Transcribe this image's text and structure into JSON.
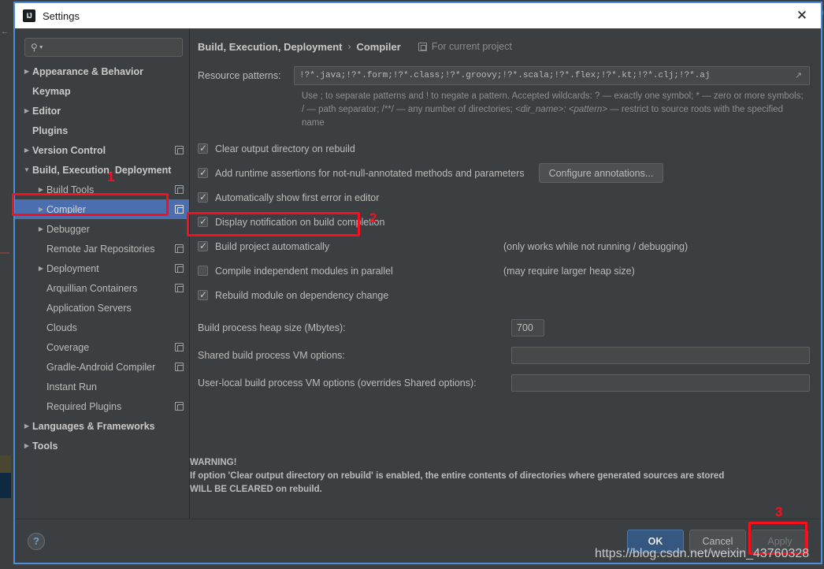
{
  "window": {
    "title": "Settings",
    "app_icon": "intellij-idea-icon",
    "close_label": "✕"
  },
  "sidebar": {
    "search": {
      "placeholder": "",
      "value": "",
      "icon": "search-icon"
    },
    "items": [
      {
        "label": "Appearance & Behavior",
        "indent": 0,
        "bold": true,
        "twisty": "▶",
        "selected": false,
        "project_icon": false
      },
      {
        "label": "Keymap",
        "indent": 0,
        "bold": true,
        "twisty": "",
        "selected": false,
        "project_icon": false
      },
      {
        "label": "Editor",
        "indent": 0,
        "bold": true,
        "twisty": "▶",
        "selected": false,
        "project_icon": false
      },
      {
        "label": "Plugins",
        "indent": 0,
        "bold": true,
        "twisty": "",
        "selected": false,
        "project_icon": false
      },
      {
        "label": "Version Control",
        "indent": 0,
        "bold": true,
        "twisty": "▶",
        "selected": false,
        "project_icon": true
      },
      {
        "label": "Build, Execution, Deployment",
        "indent": 0,
        "bold": true,
        "twisty": "▼",
        "selected": false,
        "project_icon": false
      },
      {
        "label": "Build Tools",
        "indent": 1,
        "bold": false,
        "twisty": "▶",
        "selected": false,
        "project_icon": true
      },
      {
        "label": "Compiler",
        "indent": 1,
        "bold": false,
        "twisty": "▶",
        "selected": true,
        "project_icon": true
      },
      {
        "label": "Debugger",
        "indent": 1,
        "bold": false,
        "twisty": "▶",
        "selected": false,
        "project_icon": false
      },
      {
        "label": "Remote Jar Repositories",
        "indent": 1,
        "bold": false,
        "twisty": "",
        "selected": false,
        "project_icon": true
      },
      {
        "label": "Deployment",
        "indent": 1,
        "bold": false,
        "twisty": "▶",
        "selected": false,
        "project_icon": true
      },
      {
        "label": "Arquillian Containers",
        "indent": 1,
        "bold": false,
        "twisty": "",
        "selected": false,
        "project_icon": true
      },
      {
        "label": "Application Servers",
        "indent": 1,
        "bold": false,
        "twisty": "",
        "selected": false,
        "project_icon": false
      },
      {
        "label": "Clouds",
        "indent": 1,
        "bold": false,
        "twisty": "",
        "selected": false,
        "project_icon": false
      },
      {
        "label": "Coverage",
        "indent": 1,
        "bold": false,
        "twisty": "",
        "selected": false,
        "project_icon": true
      },
      {
        "label": "Gradle-Android Compiler",
        "indent": 1,
        "bold": false,
        "twisty": "",
        "selected": false,
        "project_icon": true
      },
      {
        "label": "Instant Run",
        "indent": 1,
        "bold": false,
        "twisty": "",
        "selected": false,
        "project_icon": false
      },
      {
        "label": "Required Plugins",
        "indent": 1,
        "bold": false,
        "twisty": "",
        "selected": false,
        "project_icon": true
      },
      {
        "label": "Languages & Frameworks",
        "indent": 0,
        "bold": true,
        "twisty": "▶",
        "selected": false,
        "project_icon": false
      },
      {
        "label": "Tools",
        "indent": 0,
        "bold": true,
        "twisty": "▶",
        "selected": false,
        "project_icon": false
      }
    ]
  },
  "main": {
    "breadcrumb": {
      "parent": "Build, Execution, Deployment",
      "separator": "›",
      "current": "Compiler",
      "scope": "For current project",
      "scope_icon": "project-scope-icon"
    },
    "resource_patterns": {
      "label": "Resource patterns:",
      "value": "!?*.java;!?*.form;!?*.class;!?*.groovy;!?*.scala;!?*.flex;!?*.kt;!?*.clj;!?*.aj",
      "expand_icon": "expand-icon",
      "help_line1": "Use ; to separate patterns and ! to negate a pattern. Accepted wildcards: ? — exactly one symbol; * — zero or more symbols;",
      "help_line2_a": "/ — path separator; /**/ — any number of directories; ",
      "help_line2_i": "<dir_name>: <pattern>",
      "help_line2_b": " — restrict to source roots with the specified",
      "help_line3": "name"
    },
    "checkboxes": [
      {
        "label": "Clear output directory on rebuild",
        "checked": true,
        "note": ""
      },
      {
        "label": "Add runtime assertions for not-null-annotated methods and parameters",
        "checked": true,
        "note": ""
      },
      {
        "label": "Automatically show first error in editor",
        "checked": true,
        "note": ""
      },
      {
        "label": "Display notification on build completion",
        "checked": true,
        "note": ""
      },
      {
        "label": "Build project automatically",
        "checked": true,
        "note": "(only works while not running / debugging)"
      },
      {
        "label": "Compile independent modules in parallel",
        "checked": false,
        "note": "(may require larger heap size)"
      },
      {
        "label": "Rebuild module on dependency change",
        "checked": true,
        "note": ""
      }
    ],
    "configure_annotations_button": "Configure annotations...",
    "fields": [
      {
        "label": "Build process heap size (Mbytes):",
        "value": "700",
        "kind": "heap"
      },
      {
        "label": "Shared build process VM options:",
        "value": "",
        "kind": "wide"
      },
      {
        "label": "User-local build process VM options (overrides Shared options):",
        "value": "",
        "kind": "wide"
      }
    ],
    "warning": {
      "heading": "WARNING!",
      "line1": "If option 'Clear output directory on rebuild' is enabled, the entire contents of directories where generated sources are stored",
      "line2": "WILL BE CLEARED on rebuild."
    }
  },
  "footer": {
    "help_label": "?",
    "ok_label": "OK",
    "cancel_label": "Cancel",
    "apply_label": "Apply"
  },
  "annotations": {
    "marker1": "1",
    "marker2": "2",
    "marker3": "3",
    "box_color": "#fc0d1b"
  },
  "watermark": {
    "text": "https://blog.csdn.net/weixin_43760328"
  }
}
